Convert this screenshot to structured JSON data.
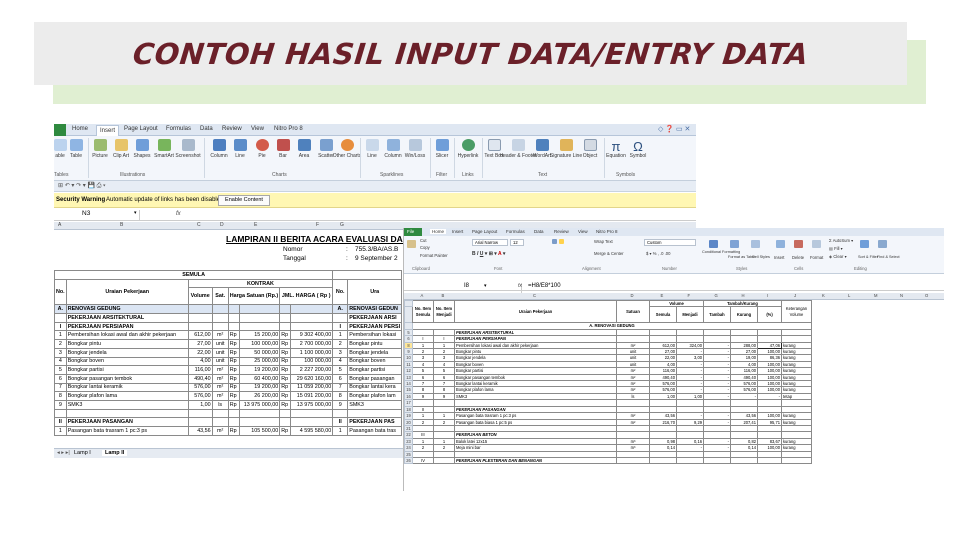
{
  "slide": {
    "title": "CONTOH HASIL INPUT DATA/ENTRY DATA"
  },
  "win1": {
    "tabs": [
      "Home",
      "Insert",
      "Page Layout",
      "Formulas",
      "Data",
      "Review",
      "View",
      "Nitro Pro 8"
    ],
    "ribbon_buttons": [
      "able",
      "Table",
      "Picture",
      "Clip Art",
      "Shapes",
      "SmartArt",
      "Screenshot",
      "Column",
      "Line",
      "Pie",
      "Bar",
      "Area",
      "Scatter",
      "Other Charts",
      "Line",
      "Column",
      "Win/Loss",
      "Slicer",
      "Hyperlink",
      "Text Box",
      "Header & Footer",
      "WordArt",
      "Signature Line",
      "Object",
      "Equation",
      "Symbol"
    ],
    "ribbon_groups": [
      "Tables",
      "Illustrations",
      "Charts",
      "Sparklines",
      "Filter",
      "Links",
      "Text",
      "Symbols"
    ],
    "security": {
      "label": "Security Warning",
      "message": "Automatic update of links has been disabled",
      "button": "Enable Content"
    },
    "name_box": "N3",
    "fx": "fx",
    "columns": [
      "A",
      "B",
      "C",
      "D",
      "E",
      "F",
      "G"
    ],
    "doc_title": "LAMPIRAN II BERITA ACARA EVALUASI DAN NEGO",
    "nomor_label": "Nomor",
    "nomor_colon": ":",
    "nomor_value": "755.3/BA/AS.B",
    "tanggal_label": "Tanggal",
    "tanggal_colon": ":",
    "tanggal_value": "9 September 2",
    "header_semula": "SEMULA",
    "header_kontrak": "KONTRAK",
    "header_no": "No.",
    "header_uraian": "Uraian Pekerjaan",
    "header_volume": "Volume",
    "header_sat": "Sat.",
    "header_harga": "Harga Satuan (Rp.)",
    "header_jml": "JML. HARGA ( Rp )",
    "header_no2": "No.",
    "header_ura2": "Ura",
    "rows": [
      {
        "no": "A.",
        "uraian": "RENOVASI GEDUNG",
        "vol": "",
        "sat": "",
        "rp1": "",
        "harga": "",
        "rp2": "",
        "jml": "",
        "no2": "A.",
        "ura2": "RENOVASI GEDUN",
        "type": "blue"
      },
      {
        "no": "",
        "uraian": "PEKERJAAN ARSITEKTURAL",
        "vol": "",
        "sat": "",
        "rp1": "",
        "harga": "",
        "rp2": "",
        "jml": "",
        "no2": "",
        "ura2": "PEKERJAAN ARSI",
        "type": "sect"
      },
      {
        "no": "I",
        "uraian": "PEKERJAAN PERSIAPAN",
        "vol": "",
        "sat": "",
        "rp1": "",
        "harga": "",
        "rp2": "",
        "jml": "",
        "no2": "I",
        "ura2": "PEKERJAAN PERSI",
        "type": "sect"
      },
      {
        "no": "1",
        "uraian": "Pembersihan lokasi awal dan akhir pekerjaan",
        "vol": "612,00",
        "sat": "m²",
        "rp1": "Rp",
        "harga": "15 200,00",
        "rp2": "Rp",
        "jml": "9 302 400,00",
        "no2": "1",
        "ura2": "Pembersihan lokasi",
        "type": ""
      },
      {
        "no": "2",
        "uraian": "Bongkar pintu",
        "vol": "27,00",
        "sat": "unit",
        "rp1": "Rp",
        "harga": "100 000,00",
        "rp2": "Rp",
        "jml": "2 700 000,00",
        "no2": "2",
        "ura2": "Bongkar pintu",
        "type": ""
      },
      {
        "no": "3",
        "uraian": "Bongkar jendela",
        "vol": "22,00",
        "sat": "unit",
        "rp1": "Rp",
        "harga": "50 000,00",
        "rp2": "Rp",
        "jml": "1 100 000,00",
        "no2": "3",
        "ura2": "Bongkar jendela",
        "type": ""
      },
      {
        "no": "4",
        "uraian": "Bongkar boven",
        "vol": "4,00",
        "sat": "unit",
        "rp1": "Rp",
        "harga": "25 000,00",
        "rp2": "Rp",
        "jml": "100 000,00",
        "no2": "4",
        "ura2": "Bongkar boven",
        "type": ""
      },
      {
        "no": "5",
        "uraian": "Bongkar partisi",
        "vol": "116,00",
        "sat": "m²",
        "rp1": "Rp",
        "harga": "19 200,00",
        "rp2": "Rp",
        "jml": "2 227 200,00",
        "no2": "5",
        "ura2": "Bongkar partisi",
        "type": ""
      },
      {
        "no": "6",
        "uraian": "Bongkar pasangan tembok",
        "vol": "490,40",
        "sat": "m²",
        "rp1": "Rp",
        "harga": "60 400,00",
        "rp2": "Rp",
        "jml": "29 620 160,00",
        "no2": "6",
        "ura2": "Bongkar pasangan",
        "type": ""
      },
      {
        "no": "7",
        "uraian": "Bongkar lantai keramik",
        "vol": "576,00",
        "sat": "m²",
        "rp1": "Rp",
        "harga": "19 200,00",
        "rp2": "Rp",
        "jml": "11 059 200,00",
        "no2": "7",
        "ura2": "Bongkar lantai kera",
        "type": ""
      },
      {
        "no": "8",
        "uraian": "Bongkar plafon lama",
        "vol": "576,00",
        "sat": "m²",
        "rp1": "Rp",
        "harga": "26 200,00",
        "rp2": "Rp",
        "jml": "15 091 200,00",
        "no2": "8",
        "ura2": "Bongkar plafon lam",
        "type": ""
      },
      {
        "no": "9",
        "uraian": "SMK3",
        "vol": "1,00",
        "sat": "ls",
        "rp1": "Rp",
        "harga": "13 975 000,00",
        "rp2": "Rp",
        "jml": "13 975 000,00",
        "no2": "9",
        "ura2": "SMK3",
        "type": ""
      },
      {
        "no": "",
        "uraian": "",
        "vol": "",
        "sat": "",
        "rp1": "",
        "harga": "",
        "rp2": "",
        "jml": "",
        "no2": "",
        "ura2": "",
        "type": ""
      },
      {
        "no": "II",
        "uraian": "PEKERJAAN PASANGAN",
        "vol": "",
        "sat": "",
        "rp1": "",
        "harga": "",
        "rp2": "",
        "jml": "",
        "no2": "II",
        "ura2": "PEKERJAAN PAS",
        "type": "sect"
      },
      {
        "no": "1",
        "uraian": "Pasangan bata trasram 1 pc:3 ps",
        "vol": "43,56",
        "sat": "m²",
        "rp1": "Rp",
        "harga": "105 500,00",
        "rp2": "Rp",
        "jml": "4 595 580,00",
        "no2": "1",
        "ura2": "Pasangan bata tras",
        "type": ""
      }
    ],
    "sheet_tabs": [
      "Lamp I",
      "Lamp II"
    ]
  },
  "win2": {
    "file_tab": "File",
    "tabs": [
      "Home",
      "Insert",
      "Page Layout",
      "Formulas",
      "Data",
      "Review",
      "View",
      "Nitro Pro 8"
    ],
    "ribbon_texts": [
      "Cut",
      "Copy",
      "Format Painter",
      "Arial Narrow",
      "12",
      "Wrap Text",
      "Custom",
      "Merge & Center",
      "Conditional Formatting",
      "Format as Table",
      "Cell Styles",
      "Insert",
      "Delete",
      "Format",
      "AutoSum",
      "Fill",
      "Clear",
      "Sort & Filter",
      "Find & Select"
    ],
    "ribbon_groups": [
      "Clipboard",
      "Font",
      "Alignment",
      "Number",
      "Styles",
      "Cells",
      "Editing"
    ],
    "name_box": "I8",
    "fx": "fx",
    "formula": "=H8/E8*100",
    "columns": [
      "A",
      "B",
      "C",
      "D",
      "E",
      "F",
      "G",
      "H",
      "I",
      "J",
      "K",
      "L",
      "M",
      "N",
      "O",
      "P"
    ],
    "header_noitem_semula": "No. Item Semula",
    "header_noitem_menjadi": "No. Item Menjadi",
    "header_uraian": "Uraian Pekerjaan",
    "header_satuan": "Satuan",
    "header_volume": "Volume",
    "header_tk": "Tambah/Kurang",
    "header_ket": "Keterangan Volume",
    "sub_semula": "Semula",
    "sub_menjadi": "Menjadi",
    "sub_tambah": "Tambah",
    "sub_kurang": "Kurang",
    "sub_pct": "(%)",
    "section_a": "A. RENOVASI GEDUNG",
    "rows": [
      {
        "rn": "5",
        "a": "",
        "b": "",
        "d": "PEKERJAAN ARSITEKTURAL",
        "e": "",
        "f": "",
        "g": "",
        "h": "",
        "i": "",
        "j": "",
        "it": true
      },
      {
        "rn": "6",
        "a": "I",
        "b": "I",
        "d": "PEKERJAAN PERSIAPAN",
        "e": "",
        "f": "",
        "g": "",
        "h": "",
        "i": "",
        "j": "",
        "it": true
      },
      {
        "rn": "8",
        "a": "1",
        "b": "1",
        "d": "Pembersihan lokasi awal dan akhir pekerjaan",
        "e": "612,00",
        "f": "324,00",
        "g": "-",
        "h": "288,00",
        "i": "47,06",
        "j": "kurang",
        "sel": true,
        "sat": "m²"
      },
      {
        "rn": "9",
        "a": "2",
        "b": "2",
        "d": "Bongkar pintu",
        "e": "27,00",
        "f": "-",
        "g": "-",
        "h": "27,00",
        "i": "100,00",
        "j": "kurang",
        "sat": "unit"
      },
      {
        "rn": "10",
        "a": "3",
        "b": "3",
        "d": "Bongkar jendela",
        "e": "22,00",
        "f": "3,00",
        "g": "-",
        "h": "19,00",
        "i": "86,36",
        "j": "kurang",
        "sat": "unit"
      },
      {
        "rn": "11",
        "a": "4",
        "b": "4",
        "d": "Bongkar boven",
        "e": "4,00",
        "f": "-",
        "g": "-",
        "h": "4,00",
        "i": "100,00",
        "j": "kurang",
        "sat": "unit"
      },
      {
        "rn": "12",
        "a": "5",
        "b": "5",
        "d": "Bongkar partisi",
        "e": "116,00",
        "f": "-",
        "g": "-",
        "h": "116,00",
        "i": "100,00",
        "j": "kurang",
        "sat": "m²"
      },
      {
        "rn": "13",
        "a": "6",
        "b": "6",
        "d": "Bongkar pasangan tembok",
        "e": "490,40",
        "f": "-",
        "g": "-",
        "h": "490,40",
        "i": "100,00",
        "j": "kurang",
        "sat": "m²"
      },
      {
        "rn": "14",
        "a": "7",
        "b": "7",
        "d": "Bongkar lantai keramik",
        "e": "576,00",
        "f": "-",
        "g": "-",
        "h": "576,00",
        "i": "100,00",
        "j": "kurang",
        "sat": "m²"
      },
      {
        "rn": "15",
        "a": "8",
        "b": "8",
        "d": "Bongkar plafon lama",
        "e": "576,00",
        "f": "-",
        "g": "-",
        "h": "576,00",
        "i": "100,00",
        "j": "kurang",
        "sat": "m²"
      },
      {
        "rn": "16",
        "a": "9",
        "b": "9",
        "d": "SMK3",
        "e": "1,00",
        "f": "1,00",
        "g": "-",
        "h": "-",
        "i": "-",
        "j": "tetap",
        "sat": "ls"
      },
      {
        "rn": "17",
        "a": "",
        "b": "",
        "d": "",
        "e": "",
        "f": "",
        "g": "",
        "h": "",
        "i": "",
        "j": ""
      },
      {
        "rn": "18",
        "a": "II",
        "b": "",
        "d": "PEKERJAAN PASANGAN",
        "e": "",
        "f": "",
        "g": "",
        "h": "",
        "i": "",
        "j": "",
        "it": true
      },
      {
        "rn": "19",
        "a": "1",
        "b": "1",
        "d": "Pasangan bata trasram 1 pc:3 ps",
        "e": "43,56",
        "f": "-",
        "g": "-",
        "h": "43,56",
        "i": "100,00",
        "j": "kurang",
        "sat": "m²"
      },
      {
        "rn": "20",
        "a": "2",
        "b": "2",
        "d": "Pasangan bata biasa 1 pc:5 ps",
        "e": "216,70",
        "f": "9,29",
        "g": "-",
        "h": "207,41",
        "i": "95,71",
        "j": "kurang",
        "sat": "m²"
      },
      {
        "rn": "21",
        "a": "",
        "b": "",
        "d": "",
        "e": "",
        "f": "",
        "g": "",
        "h": "",
        "i": "",
        "j": ""
      },
      {
        "rn": "22",
        "a": "III",
        "b": "",
        "d": "PEKERJAAN BETON",
        "e": "",
        "f": "",
        "g": "",
        "h": "",
        "i": "",
        "j": "",
        "it": true
      },
      {
        "rn": "23",
        "a": "1",
        "b": "1",
        "d": "Balok latei 12x15",
        "e": "0,98",
        "f": "0,16",
        "g": "-",
        "h": "0,82",
        "i": "83,67",
        "j": "kurang",
        "sat": "m³"
      },
      {
        "rn": "24",
        "a": "2",
        "b": "2",
        "d": "Meja mini bar",
        "e": "0,14",
        "f": "-",
        "g": "-",
        "h": "0,14",
        "i": "100,00",
        "j": "kurang",
        "sat": "m³"
      },
      {
        "rn": "25",
        "a": "",
        "b": "",
        "d": "",
        "e": "",
        "f": "",
        "g": "",
        "h": "",
        "i": "",
        "j": ""
      },
      {
        "rn": "26",
        "a": "IV",
        "b": "",
        "d": "PEKERJAAN PLESTERAN DAN BENANGAN",
        "e": "",
        "f": "",
        "g": "",
        "h": "",
        "i": "",
        "j": "",
        "it": true
      }
    ]
  }
}
